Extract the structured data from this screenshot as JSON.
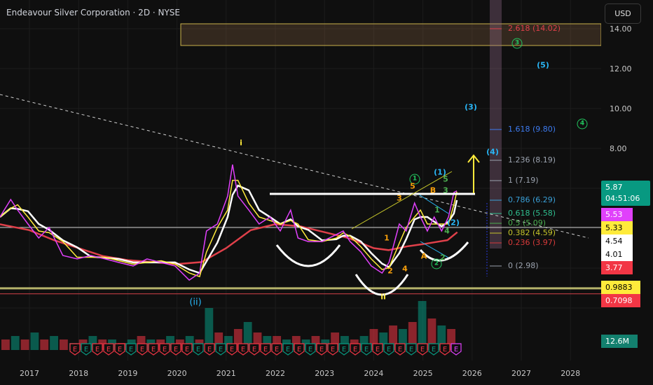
{
  "header": {
    "title": "Endeavour Silver Corporation · 2D · NYSE",
    "currency": "USD"
  },
  "price_axis": {
    "ticks": [
      "14.00",
      "12.00",
      "10.00",
      "8.00"
    ]
  },
  "time_axis": {
    "ticks": [
      "2017",
      "2018",
      "2019",
      "2020",
      "2021",
      "2022",
      "2023",
      "2024",
      "2025",
      "2026",
      "2027",
      "2028"
    ]
  },
  "price_labels": {
    "last": "5.87",
    "countdown": "04:51:06",
    "ma1": "5.53",
    "ma2": "5.33",
    "l1": "4.54",
    "l2": "4.01",
    "l3": "3.77",
    "support1": "0.9883",
    "support2": "0.7098",
    "volume": "12.6M"
  },
  "colors": {
    "green": "#089981",
    "red": "#f23645",
    "magenta": "#e040fb",
    "yellow": "#ffeb3b",
    "cyan": "#29b6f6",
    "orange": "#f59e0b",
    "wave_green": "#22c55e"
  },
  "fib_levels": [
    {
      "label": "2.618 (14.02)",
      "color": "#e0404a"
    },
    {
      "label": "1.618 (9.80)",
      "color": "#3d7bf0"
    },
    {
      "label": "1.236 (8.19)",
      "color": "#9ca3af"
    },
    {
      "label": "1 (7.19)",
      "color": "#9ca3af"
    },
    {
      "label": "0.786 (6.29)",
      "color": "#3aa0d8"
    },
    {
      "label": "0.618 (5.58)",
      "color": "#2fbf8f"
    },
    {
      "label": "0.5 (5.09)",
      "color": "#4caf50"
    },
    {
      "label": "0.382 (4.59)",
      "color": "#c6c62a"
    },
    {
      "label": "0.236 (3.97)",
      "color": "#d93a3a"
    },
    {
      "label": "0 (2.98)",
      "color": "#9ca3af"
    }
  ],
  "annotations": {
    "i": "i",
    "ii": "ii",
    "paren_ii": "(ii)",
    "w1": "(1)",
    "w2": "(2)",
    "w3": "(3)",
    "w4": "(4)",
    "w5": "(5)",
    "c1": "1",
    "c2": "2",
    "c3": "3",
    "c4": "4",
    "o1": "1",
    "o2": "2",
    "o3": "3",
    "o4": "4",
    "o5": "5",
    "oA": "A",
    "oB": "B",
    "g1": "1",
    "g2": "2",
    "g3": "3",
    "g4": "4",
    "g5": "5"
  },
  "chart_data": {
    "type": "line",
    "title": "Endeavour Silver Corporation · 2D · NYSE",
    "ylim": [
      -0.5,
      15
    ],
    "xlim": [
      2016.4,
      2028.6
    ],
    "close": [
      [
        2016.4,
        4.56
      ],
      [
        2016.62,
        5.44
      ],
      [
        2016.76,
        4.91
      ],
      [
        2016.97,
        4.21
      ],
      [
        2017.19,
        3.51
      ],
      [
        2017.4,
        4.04
      ],
      [
        2017.68,
        2.63
      ],
      [
        2017.97,
        2.46
      ],
      [
        2018.25,
        2.63
      ],
      [
        2018.54,
        2.46
      ],
      [
        2018.82,
        2.28
      ],
      [
        2019.11,
        2.11
      ],
      [
        2019.39,
        2.46
      ],
      [
        2019.68,
        2.28
      ],
      [
        2019.96,
        2.11
      ],
      [
        2020.25,
        1.4
      ],
      [
        2020.46,
        1.75
      ],
      [
        2020.6,
        3.86
      ],
      [
        2020.82,
        4.21
      ],
      [
        2021.03,
        5.61
      ],
      [
        2021.13,
        7.19
      ],
      [
        2021.24,
        5.61
      ],
      [
        2021.46,
        4.91
      ],
      [
        2021.67,
        4.21
      ],
      [
        2021.89,
        4.56
      ],
      [
        2022.1,
        3.86
      ],
      [
        2022.31,
        4.91
      ],
      [
        2022.46,
        3.51
      ],
      [
        2022.67,
        3.33
      ],
      [
        2022.95,
        3.33
      ],
      [
        2023.24,
        3.68
      ],
      [
        2023.38,
        3.86
      ],
      [
        2023.52,
        3.33
      ],
      [
        2023.74,
        2.81
      ],
      [
        2023.95,
        2.11
      ],
      [
        2024.17,
        1.75
      ],
      [
        2024.31,
        2.28
      ],
      [
        2024.52,
        4.21
      ],
      [
        2024.66,
        3.86
      ],
      [
        2024.83,
        5.26
      ],
      [
        2024.95,
        4.56
      ],
      [
        2025.09,
        3.86
      ],
      [
        2025.23,
        4.56
      ],
      [
        2025.38,
        3.86
      ],
      [
        2025.52,
        4.56
      ],
      [
        2025.63,
        5.79
      ],
      [
        2025.69,
        5.87
      ]
    ],
    "ma_slow": [
      [
        2016.4,
        4.2
      ],
      [
        2017,
        3.9
      ],
      [
        2017.5,
        3.4
      ],
      [
        2018,
        3.0
      ],
      [
        2018.5,
        2.6
      ],
      [
        2019,
        2.4
      ],
      [
        2019.5,
        2.3
      ],
      [
        2020,
        2.2
      ],
      [
        2020.5,
        2.3
      ],
      [
        2021,
        3.0
      ],
      [
        2021.5,
        3.9
      ],
      [
        2022,
        4.2
      ],
      [
        2022.5,
        4.1
      ],
      [
        2023,
        3.8
      ],
      [
        2023.5,
        3.5
      ],
      [
        2024,
        3.0
      ],
      [
        2024.3,
        2.9
      ],
      [
        2024.7,
        3.1
      ],
      [
        2025,
        3.2
      ],
      [
        2025.5,
        3.4
      ],
      [
        2025.7,
        3.8
      ]
    ],
    "horizontal_levels": [
      {
        "price": 5.72,
        "color": "#ffffff"
      },
      {
        "price": 4.04,
        "color": "#cfcfcf"
      },
      {
        "price": 0.9883,
        "color": "#b5b26a"
      },
      {
        "price": 0.7098,
        "color": "#d6404a"
      }
    ],
    "volume_relative": [
      3,
      4,
      3,
      5,
      3,
      4,
      3,
      2,
      3,
      4,
      3,
      3,
      2,
      3,
      4,
      3,
      3,
      4,
      3,
      4,
      3,
      12,
      5,
      4,
      6,
      8,
      5,
      4,
      4,
      3,
      4,
      3,
      4,
      3,
      5,
      4,
      3,
      4,
      6,
      5,
      7,
      6,
      8,
      14,
      9,
      7,
      6
    ],
    "earnings": [
      "r",
      "g",
      "r",
      "r",
      "r",
      "g",
      "r",
      "r",
      "r",
      "r",
      "r",
      "g",
      "r",
      "g",
      "r",
      "r",
      "r",
      "r",
      "r",
      "g",
      "r",
      "g",
      "r",
      "r",
      "g",
      "r",
      "g",
      "r",
      "g",
      "r",
      "g",
      "r",
      "g",
      "r",
      "m"
    ]
  }
}
